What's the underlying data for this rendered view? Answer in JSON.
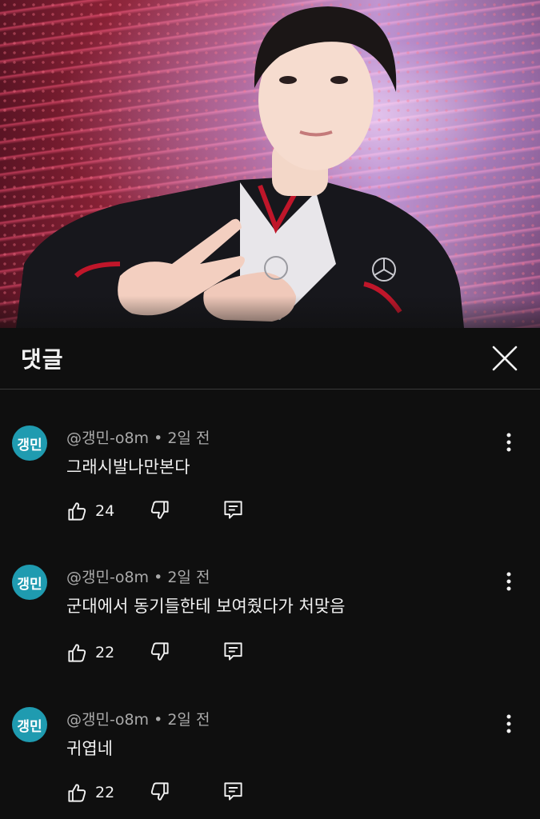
{
  "panel": {
    "title": "댓글",
    "close_icon": "close-icon"
  },
  "comments": [
    {
      "avatar_text": "갱민",
      "author": "@갱민-o8m",
      "time": "2일 전",
      "text": "그래시발나만본다",
      "likes": "24"
    },
    {
      "avatar_text": "갱민",
      "author": "@갱민-o8m",
      "time": "2일 전",
      "text": "군대에서 동기들한테 보여줬다가 처맞음",
      "likes": "22"
    },
    {
      "avatar_text": "갱민",
      "author": "@갱민-o8m",
      "time": "2일 전",
      "text": "귀엽네",
      "likes": "22"
    }
  ],
  "colors": {
    "background": "#0f0f0f",
    "avatar": "#1f9bb0",
    "meta_text": "#aaaaaa"
  },
  "icons": [
    "like-icon",
    "dislike-icon",
    "reply-icon",
    "more-options-icon"
  ]
}
